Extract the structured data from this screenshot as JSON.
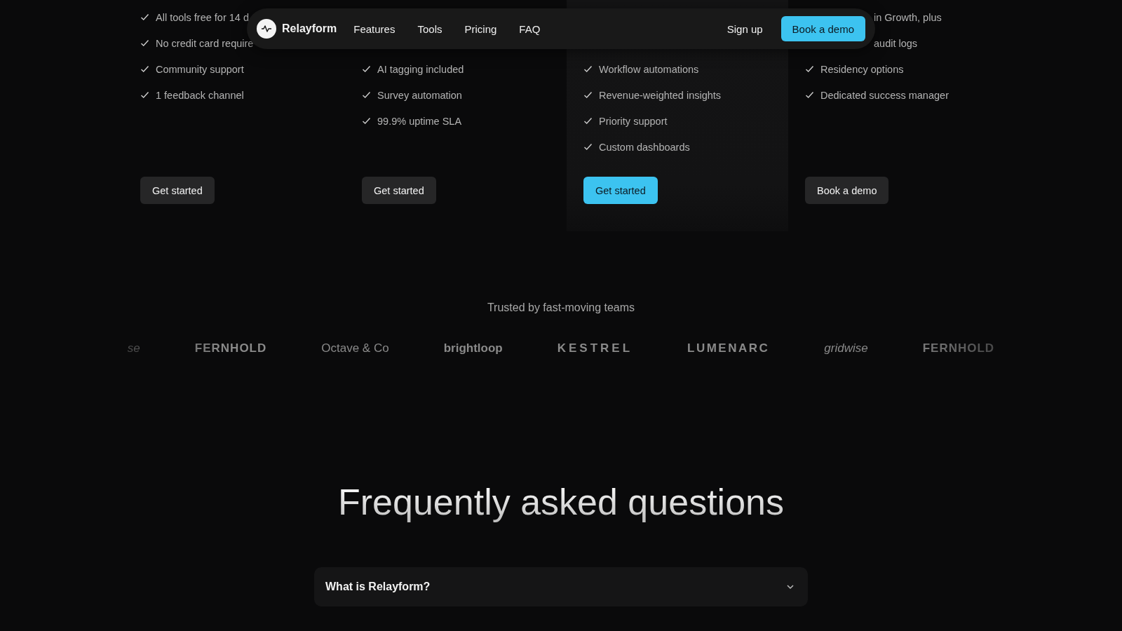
{
  "nav": {
    "brand": "Relayform",
    "links": [
      "Features",
      "Tools",
      "Pricing",
      "FAQ"
    ],
    "signup": "Sign up",
    "cta": "Book a demo"
  },
  "plans": [
    {
      "features": [
        {
          "kind": "full",
          "text": "All tools free for 14 d"
        },
        {
          "kind": "full",
          "text": "No credit card require"
        },
        {
          "kind": "full",
          "text": "Community support"
        },
        {
          "kind": "full",
          "text": "1 feedback channel"
        }
      ],
      "button": {
        "label": "Get started",
        "primary": false
      }
    },
    {
      "features": [
        {
          "kind": "full",
          "text": "AI tagging included"
        },
        {
          "kind": "full",
          "text": "Survey automation"
        },
        {
          "kind": "full",
          "text": "99.9% uptime SLA"
        }
      ],
      "button": {
        "label": "Get started",
        "primary": false
      }
    },
    {
      "features": [
        {
          "kind": "full",
          "text": "Workflow automations"
        },
        {
          "kind": "full",
          "text": "Revenue-weighted insights"
        },
        {
          "kind": "full",
          "text": "Priority support"
        },
        {
          "kind": "full",
          "text": "Custom dashboards"
        }
      ],
      "button": {
        "label": "Get started",
        "primary": true
      }
    },
    {
      "features": [
        {
          "kind": "clipped",
          "text": "in Growth, plus"
        },
        {
          "kind": "clipped",
          "text": "audit logs"
        },
        {
          "kind": "full",
          "text": "Residency options"
        },
        {
          "kind": "full",
          "text": "Dedicated success manager"
        }
      ],
      "button": {
        "label": "Book a demo",
        "primary": false
      }
    }
  ],
  "trusted": {
    "caption": "Trusted by fast-moving teams",
    "logos": [
      {
        "kind": "italic",
        "text": "se"
      },
      {
        "kind": "heavy",
        "text": "FERNHOLD"
      },
      {
        "kind": "plain",
        "text": "Octave & Co"
      },
      {
        "kind": "bold",
        "text": "brightloop"
      },
      {
        "kind": "spaced",
        "text": "KESTREL"
      },
      {
        "kind": "wide",
        "text": "LUMENARC"
      },
      {
        "kind": "italic",
        "text": "gridwise"
      },
      {
        "kind": "heavy",
        "text": "FERNHOLD"
      }
    ]
  },
  "faq": {
    "title": "Frequently asked questions",
    "items": [
      {
        "question": "What is Relayform?",
        "expanded": false
      }
    ]
  }
}
